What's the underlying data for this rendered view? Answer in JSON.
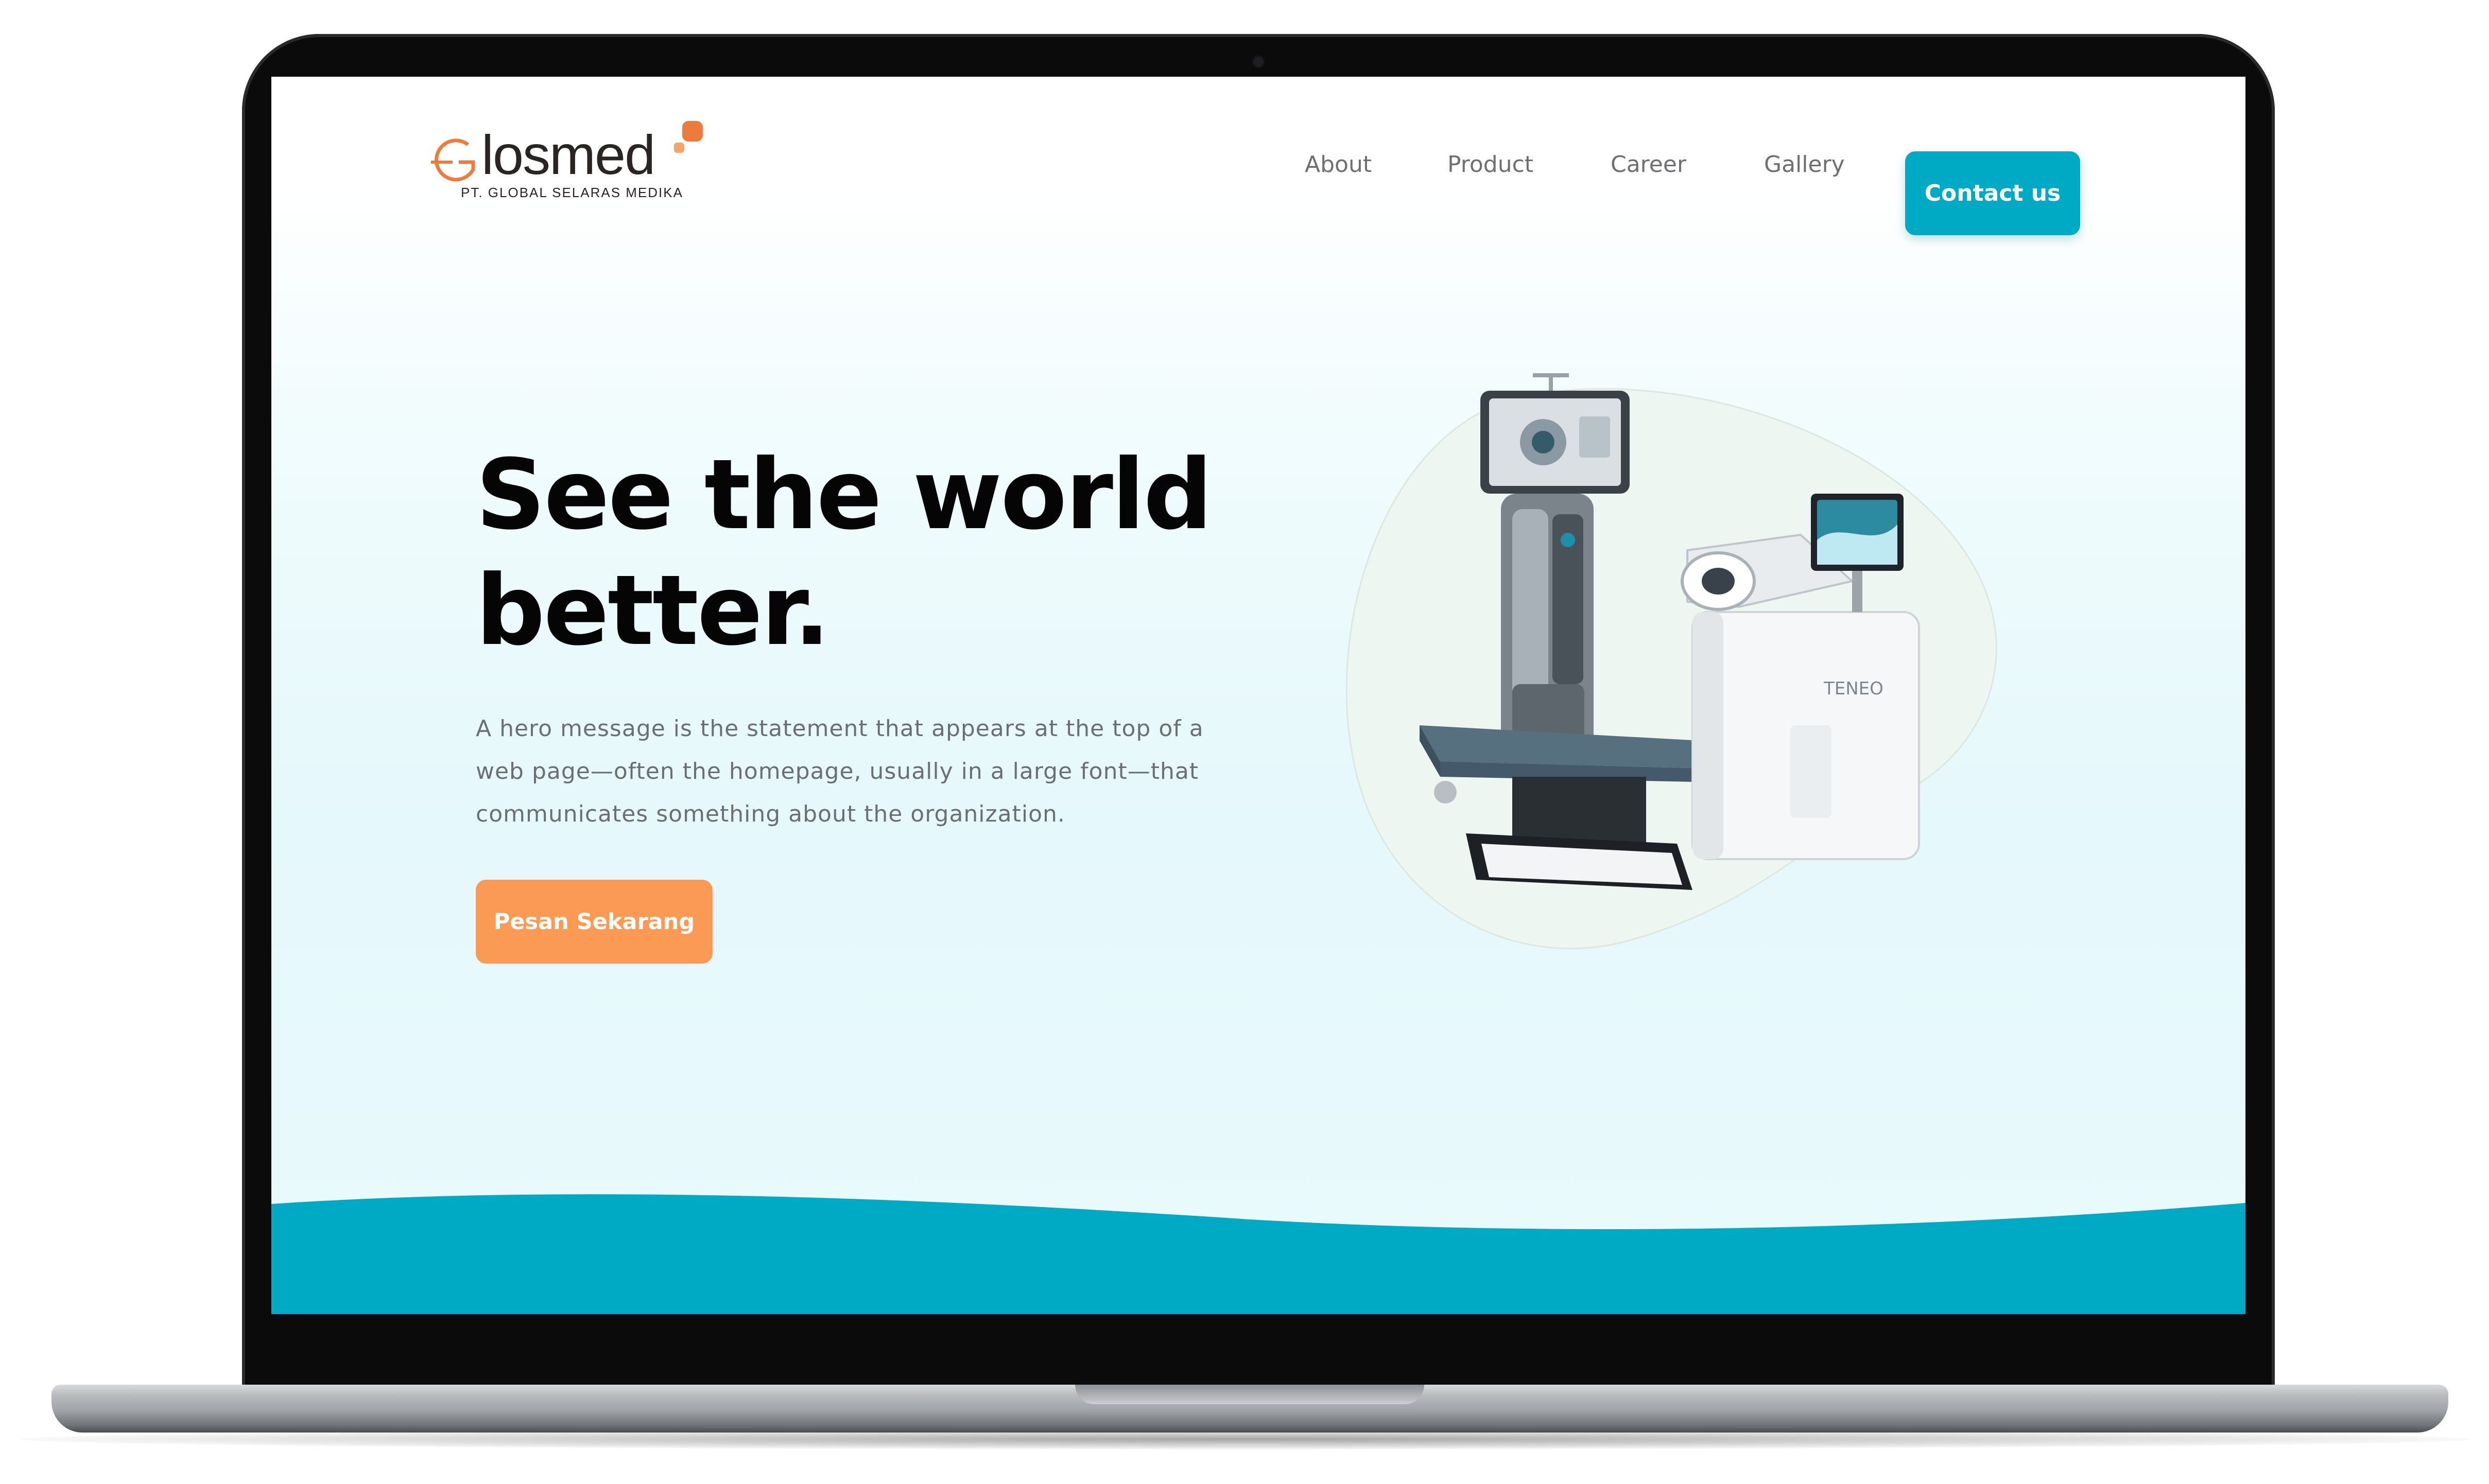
{
  "brand": {
    "name": "Glosmed",
    "tagline": "PT. GLOBAL SELARAS MEDIKA",
    "colors": {
      "primary": "#00aac4",
      "accent": "#fa9a55",
      "logo_orange": "#ec7b3d"
    }
  },
  "nav": {
    "links": [
      "About",
      "Product",
      "Career",
      "Gallery"
    ],
    "contact_label": "Contact us"
  },
  "hero": {
    "headline_line1": "See the world",
    "headline_line2": "better.",
    "description_lines": [
      "A hero message is the statement that appears at the top of a",
      "web page—often the homepage, usually in a large font—that",
      "communicates something about the organization."
    ],
    "cta_label": "Pesan Sekarang",
    "device_label": "TENEO"
  },
  "icons": {
    "logo": "glosmed-logo",
    "device": "laser-device-illustration"
  }
}
